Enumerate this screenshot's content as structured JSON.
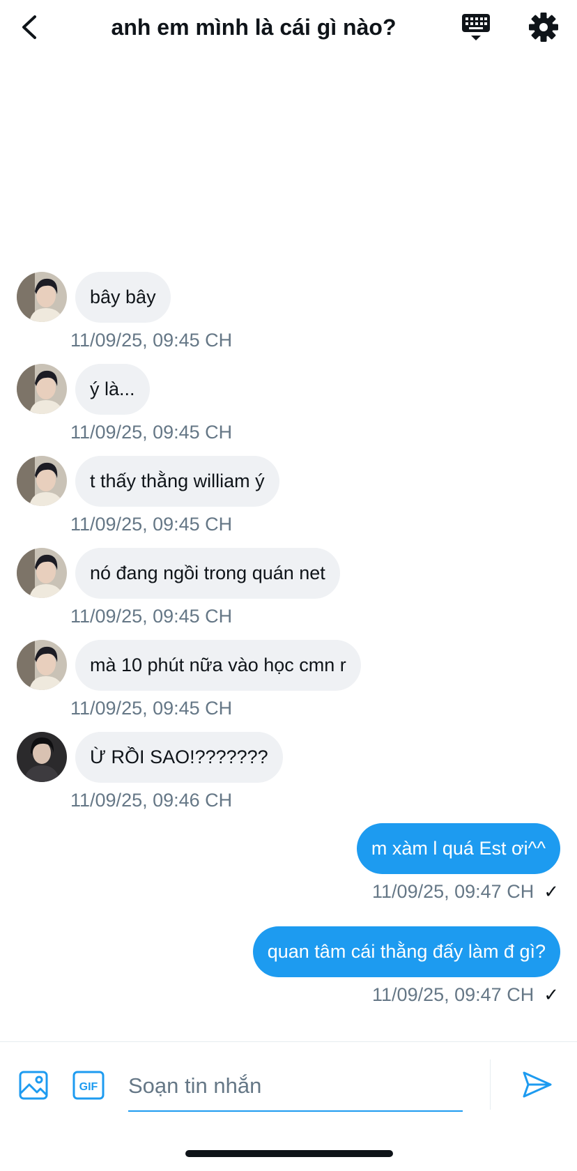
{
  "header": {
    "title": "anh em mình là cái gì nào?",
    "back_icon": "chevron-left-icon",
    "keyboard_icon": "keyboard-icon",
    "settings_icon": "gear-icon"
  },
  "messages": [
    {
      "direction": "incoming",
      "text": "bây bây",
      "timestamp": "11/09/25, 09:45 CH"
    },
    {
      "direction": "incoming",
      "text": "ý là...",
      "timestamp": "11/09/25, 09:45 CH"
    },
    {
      "direction": "incoming",
      "text": "t thấy thằng william ý",
      "timestamp": "11/09/25, 09:45 CH"
    },
    {
      "direction": "incoming",
      "text": "nó đang ngồi trong quán net",
      "timestamp": "11/09/25, 09:45 CH"
    },
    {
      "direction": "incoming",
      "text": "mà 10 phút nữa vào học cmn r",
      "timestamp": "11/09/25, 09:45 CH"
    },
    {
      "direction": "incoming",
      "text": "Ừ RỒI SAO!???????",
      "timestamp": "11/09/25, 09:46 CH"
    },
    {
      "direction": "outgoing",
      "text": "m xàm l quá Est ơi^^",
      "timestamp": "11/09/25, 09:47 CH",
      "status": "✓"
    },
    {
      "direction": "outgoing",
      "text": "quan tâm cái thằng đấy làm đ gì?",
      "timestamp": "11/09/25, 09:47 CH",
      "status": "✓"
    }
  ],
  "composer": {
    "placeholder": "Soạn tin nhắn",
    "value": "",
    "media_icon": "image-icon",
    "gif_icon": "gif-icon",
    "send_icon": "send-icon",
    "gif_label": "GIF"
  },
  "colors": {
    "accent": "#1d9bf0",
    "incoming_bubble": "#eff1f4",
    "timestamp": "#657786",
    "text": "#0f1419"
  }
}
